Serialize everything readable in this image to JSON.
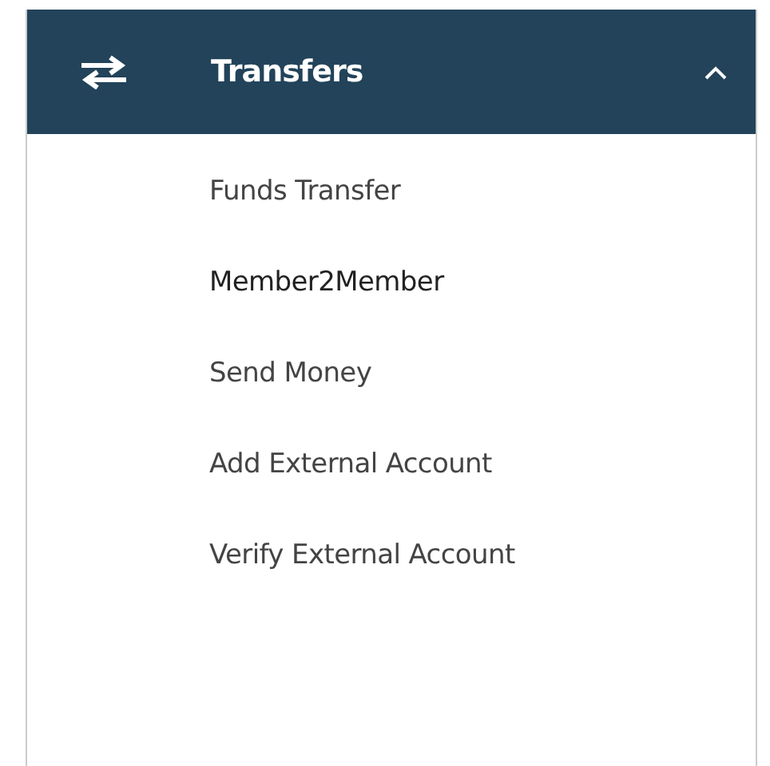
{
  "menu": {
    "title": "Transfers",
    "expanded": true,
    "items": [
      {
        "label": "Funds Transfer",
        "selected": false
      },
      {
        "label": "Member2Member",
        "selected": true
      },
      {
        "label": "Send Money",
        "selected": false
      },
      {
        "label": "Add External Account",
        "selected": false
      },
      {
        "label": "Verify External Account",
        "selected": false
      }
    ]
  }
}
